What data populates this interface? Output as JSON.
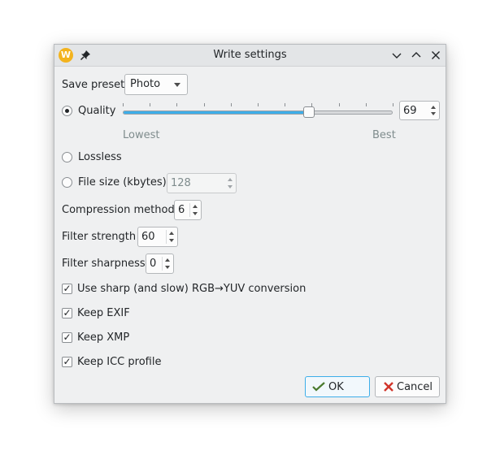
{
  "window": {
    "title": "Write settings",
    "app_icon_letter": "W"
  },
  "save_preset": {
    "label": "Save preset",
    "selected": "Photo"
  },
  "quality": {
    "label": "Quality",
    "checked": true,
    "value": "69",
    "slider_min": 0,
    "slider_max": 100,
    "slider_value": 69,
    "lowest_label": "Lowest",
    "best_label": "Best"
  },
  "lossless": {
    "label": "Lossless",
    "checked": false
  },
  "file_size": {
    "label": "File size (kbytes)",
    "checked": false,
    "value": "128"
  },
  "compression_method": {
    "label": "Compression method",
    "value": "6"
  },
  "filter_strength": {
    "label": "Filter strength",
    "value": "60"
  },
  "filter_sharpness": {
    "label": "Filter sharpness",
    "value": "0"
  },
  "checkboxes": {
    "sharp_yuv": {
      "label": "Use sharp (and slow) RGB→YUV conversion",
      "checked": true
    },
    "keep_exif": {
      "label": "Keep EXIF",
      "checked": true
    },
    "keep_xmp": {
      "label": "Keep XMP",
      "checked": true
    },
    "keep_icc": {
      "label": "Keep ICC profile",
      "checked": true
    }
  },
  "buttons": {
    "ok": "OK",
    "cancel": "Cancel"
  },
  "colors": {
    "accent": "#3daee9",
    "app_icon": "#f3b31e",
    "ok_icon": "#4a7a2e",
    "cancel_icon": "#d1342a"
  },
  "icons": {
    "app": "app-logo-icon",
    "pin": "pin-icon",
    "minimize": "chevron-down-icon",
    "maximize": "chevron-up-icon",
    "close": "close-icon",
    "ok": "checkmark-icon",
    "cancel": "cancel-x-icon"
  }
}
